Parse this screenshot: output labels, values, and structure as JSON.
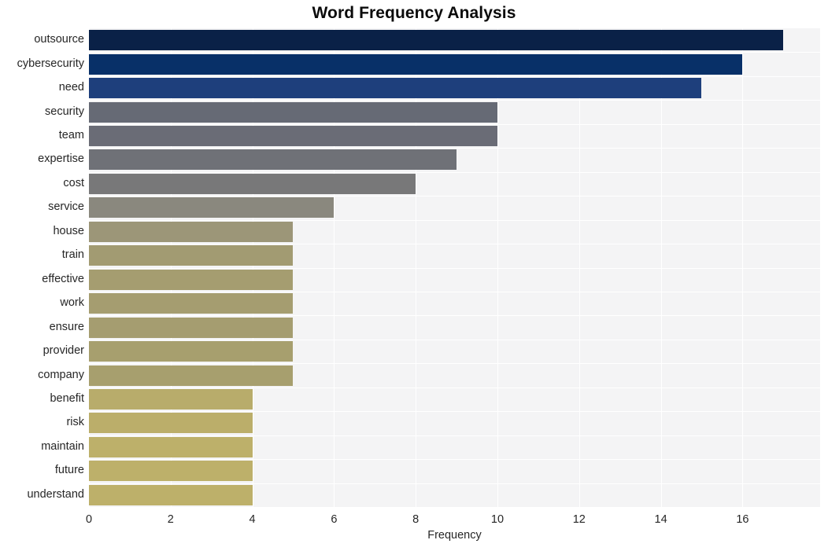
{
  "chart_data": {
    "type": "bar",
    "orientation": "horizontal",
    "title": "Word Frequency Analysis",
    "xlabel": "Frequency",
    "ylabel": "",
    "xlim": [
      0,
      17.9
    ],
    "ylim": null,
    "grid": true,
    "legend": null,
    "xticks": [
      0,
      2,
      4,
      6,
      8,
      10,
      12,
      14,
      16
    ],
    "xtick_labels": [
      "0",
      "2",
      "4",
      "6",
      "8",
      "10",
      "12",
      "14",
      "16"
    ],
    "categories": [
      "outsource",
      "cybersecurity",
      "need",
      "security",
      "team",
      "expertise",
      "cost",
      "service",
      "house",
      "train",
      "effective",
      "work",
      "ensure",
      "provider",
      "company",
      "benefit",
      "risk",
      "maintain",
      "future",
      "understand"
    ],
    "values": [
      17,
      16,
      15,
      10,
      10,
      9,
      8,
      6,
      5,
      5,
      5,
      5,
      5,
      5,
      5,
      4,
      4,
      4,
      4,
      4
    ],
    "bar_colors": [
      "#0a2147",
      "#083068",
      "#1e3f7c",
      "#666a75",
      "#6a6c76",
      "#6f7177",
      "#787879",
      "#8a887e",
      "#9c9678",
      "#a29b72",
      "#a59d70",
      "#a59d70",
      "#a59d70",
      "#a79f6e",
      "#a79f6e",
      "#b8ac6b",
      "#bbae6a",
      "#bdb06a",
      "#bdb06a",
      "#bdb06a"
    ],
    "plot_background": "#f4f4f5",
    "gridline_color": "#ffffff",
    "figure_background": "#ffffff"
  }
}
